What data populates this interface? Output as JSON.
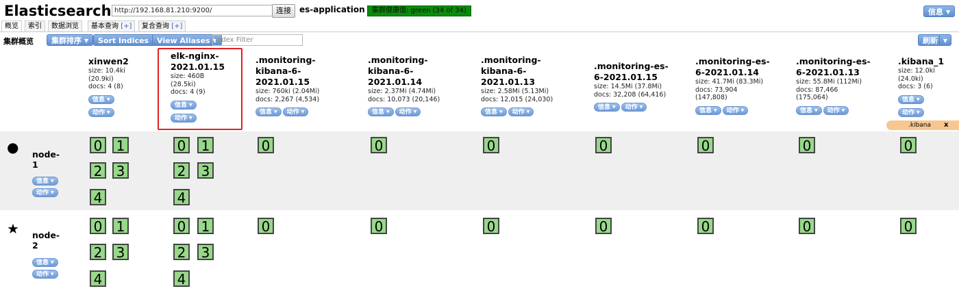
{
  "header": {
    "title": "Elasticsearch",
    "url": "http://192.168.81.210:9200/",
    "connect_label": "连接",
    "cluster_name": "es-application",
    "health": "集群健康值: green (34 of 34)",
    "info_label": "信息"
  },
  "tabs": [
    {
      "label": "概览"
    },
    {
      "label": "索引"
    },
    {
      "label": "数据浏览"
    },
    {
      "label": "基本查询",
      "plus": "[+]"
    },
    {
      "label": "复合查询",
      "plus": "[+]"
    }
  ],
  "toolbar": {
    "overview_label": "集群概览",
    "cluster_sort": "集群排序",
    "sort_indices": "Sort Indices",
    "view_aliases": "View Aliases",
    "index_filter_placeholder": "Index Filter",
    "refresh": "刷新"
  },
  "common": {
    "info": "信息",
    "action": "动作"
  },
  "indices": [
    {
      "name": "xinwen2",
      "meta": "size: 10.4ki\n(20.9ki)\ndocs: 4 (8)"
    },
    {
      "name": "elk-nginx-\n2021.01.15",
      "meta": "size: 460B\n(28.5ki)\ndocs: 4 (9)"
    },
    {
      "name": ".monitoring-\nkibana-6-\n2021.01.15",
      "meta": "size: 760ki (2.04Mi)\ndocs: 2,267 (4,534)"
    },
    {
      "name": ".monitoring-\nkibana-6-\n2021.01.14",
      "meta": "size: 2.37Mi (4.74Mi)\ndocs: 10,073 (20,146)"
    },
    {
      "name": ".monitoring-\nkibana-6-\n2021.01.13",
      "meta": "size: 2.58Mi (5.13Mi)\ndocs: 12,015 (24,030)"
    },
    {
      "name": ".monitoring-es-\n6-2021.01.15",
      "meta": "size: 14.5Mi (37.8Mi)\ndocs: 32,208 (64,416)"
    },
    {
      "name": ".monitoring-es-\n6-2021.01.14",
      "meta": "size: 41.7Mi (83.3Mi)\ndocs: 73,904\n(147,808)"
    },
    {
      "name": ".monitoring-es-\n6-2021.01.13",
      "meta": "size: 55.8Mi (112Mi)\ndocs: 87,466\n(175,064)"
    },
    {
      "name": ".kibana_1",
      "meta": "size: 12.0ki\n(24.0ki)\ndocs: 3 (6)"
    }
  ],
  "alias": {
    "name": ".kibana",
    "close": "x"
  },
  "nodes": [
    {
      "name": "node-\n1",
      "icon": "circle-icon",
      "glyph": "●"
    },
    {
      "name": "node-\n2",
      "icon": "star-icon",
      "glyph": "★"
    }
  ],
  "shards": {
    "multi": [
      "0",
      "1",
      "2",
      "3",
      "4"
    ],
    "single": "0"
  }
}
